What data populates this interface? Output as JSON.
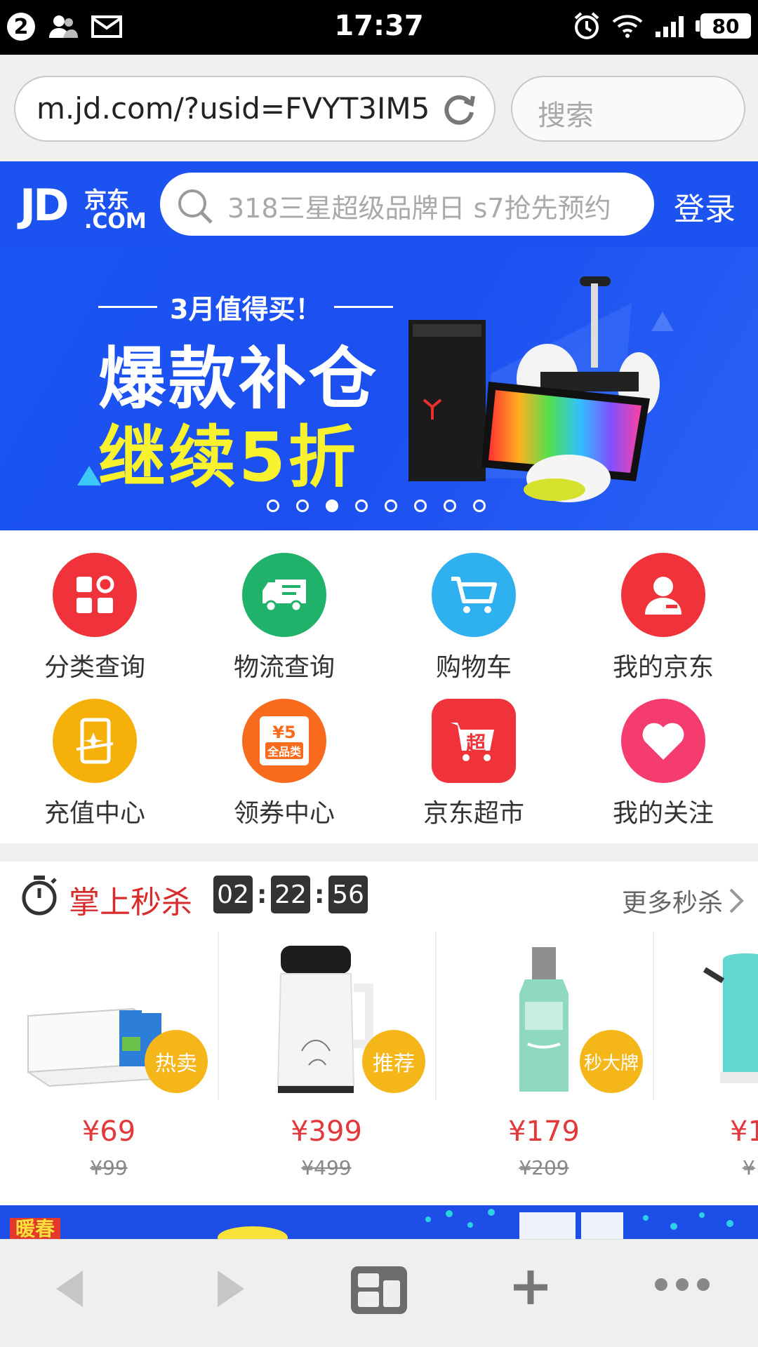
{
  "status_bar": {
    "notification_count": "2",
    "time": "17:37",
    "battery": "80",
    "icons": [
      "contacts-icon",
      "mail-icon",
      "alarm-icon",
      "wifi-icon",
      "signal-icon",
      "battery-icon"
    ]
  },
  "browser": {
    "url": "m.jd.com/?usid=FVYT3IM5",
    "search_placeholder": "搜索"
  },
  "jd_header": {
    "logo_text": "JD",
    "logo_cn": "京东",
    "logo_com": ".COM",
    "search_placeholder": "318三星超级品牌日 s7抢先预约",
    "login_label": "登录"
  },
  "banner": {
    "subtitle": "3月值得买！",
    "title_line1": "爆款补仓",
    "title_line2": "继续5折",
    "slide_count": 8,
    "active_slide": 3
  },
  "grid": {
    "items": [
      {
        "label": "分类查询",
        "icon": "category-icon",
        "color": "#f0333a"
      },
      {
        "label": "物流查询",
        "icon": "truck-icon",
        "color": "#20b26a"
      },
      {
        "label": "购物车",
        "icon": "cart-icon",
        "color": "#2fb1f0"
      },
      {
        "label": "我的京东",
        "icon": "user-icon",
        "color": "#f0333a"
      },
      {
        "label": "充值中心",
        "icon": "phone-recharge-icon",
        "color": "#f5b10a"
      },
      {
        "label": "领券中心",
        "icon": "coupon-icon",
        "color": "#f86a1c"
      },
      {
        "label": "京东超市",
        "icon": "supermarket-cart-icon",
        "color": "#f0333a"
      },
      {
        "label": "我的关注",
        "icon": "heart-icon",
        "color": "#f53c6f"
      }
    ],
    "coupon_text_top": "¥5",
    "coupon_text_bottom": "全品类",
    "supermarket_char": "超"
  },
  "flash_sale": {
    "title": "掌上秒杀",
    "timer": {
      "hours": "02",
      "minutes": "22",
      "seconds": "56"
    },
    "more_label": "更多秒杀",
    "products": [
      {
        "tag": "热卖",
        "price": "¥69",
        "original": "¥99",
        "image": "milk-box-image"
      },
      {
        "tag": "推荐",
        "price": "¥399",
        "original": "¥499",
        "image": "soymilk-maker-image"
      },
      {
        "tag": "秒大牌",
        "price": "¥179",
        "original": "¥209",
        "image": "toner-bottle-image"
      },
      {
        "tag": "",
        "price": "¥1",
        "original": "¥",
        "image": "kettle-image"
      }
    ]
  },
  "promo_strip": {
    "badge": "暖春"
  },
  "toolbar": {
    "icons": [
      "back-icon",
      "forward-icon",
      "tabs-icon",
      "new-tab-icon",
      "more-icon"
    ]
  }
}
